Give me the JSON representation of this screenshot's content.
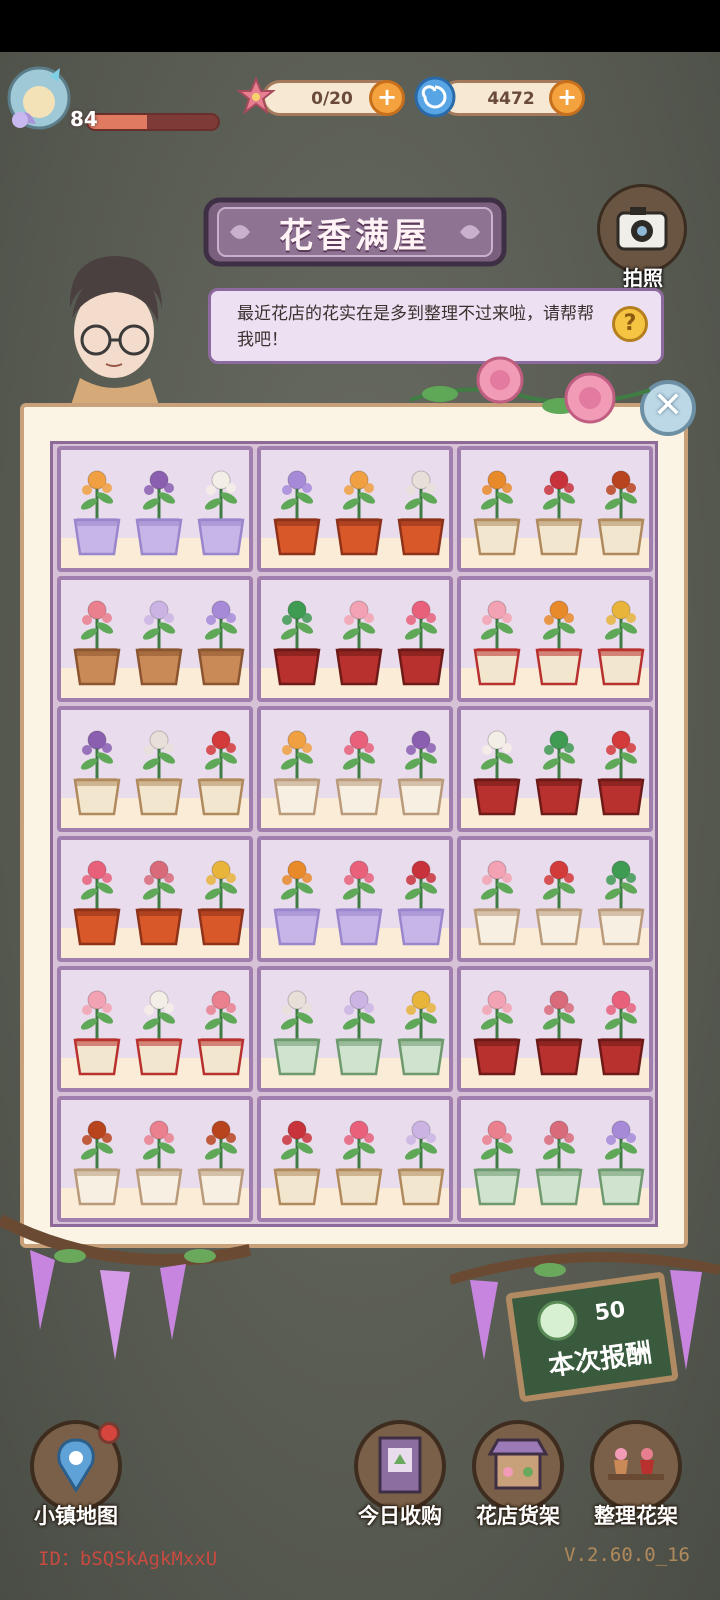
{
  "hud": {
    "level": "84",
    "level_progress": 0.45,
    "flowers": "0/20",
    "currency": "4472"
  },
  "title": "花香满屋",
  "camera_label": "拍照",
  "dialog": "最近花店的花实在是多到整理不过来啦，请帮帮我吧！",
  "help_icon": "?",
  "close_icon": "✕",
  "reward": {
    "value": "50",
    "label": "本次报酬"
  },
  "nav": {
    "map": "小镇地图",
    "purchase": "今日收购",
    "shelf": "花店货架",
    "arrange": "整理花架"
  },
  "footer": {
    "id": "ID：bSQSkAgkMxxU",
    "version": "V.2.60.0_16"
  },
  "colors": {
    "pot_cream": "#f2e6cf",
    "pot_red": "#b8312e",
    "pot_terracotta": "#c98a57",
    "pot_orange": "#d8582a",
    "pot_crystal": "#c6b6e8",
    "pot_mint": "#cfe3cf"
  },
  "shelves": [
    {
      "pots": [
        {
          "pot": "crystal",
          "flower": "orange-spike"
        },
        {
          "pot": "crystal",
          "flower": "purple-tulip"
        },
        {
          "pot": "crystal",
          "flower": "white-spike"
        }
      ]
    },
    {
      "pots": [
        {
          "pot": "orange",
          "flower": "purple-bell"
        },
        {
          "pot": "orange",
          "flower": "orange-spike"
        },
        {
          "pot": "orange",
          "flower": "lily"
        }
      ]
    },
    {
      "pots": [
        {
          "pot": "bow",
          "flower": "marigold"
        },
        {
          "pot": "bow",
          "flower": "red-rose"
        },
        {
          "pot": "bow",
          "flower": "autumn"
        }
      ]
    },
    {
      "pots": [
        {
          "pot": "terracotta",
          "flower": "pink-lily"
        },
        {
          "pot": "terracotta",
          "flower": "orchid"
        },
        {
          "pot": "terracotta",
          "flower": "purple-bell"
        }
      ]
    },
    {
      "pots": [
        {
          "pot": "red",
          "flower": "green-clover"
        },
        {
          "pot": "red",
          "flower": "pink-bloom"
        },
        {
          "pot": "red",
          "flower": "pink-rose"
        }
      ]
    },
    {
      "pots": [
        {
          "pot": "red-band",
          "flower": "pink-bloom"
        },
        {
          "pot": "red-band",
          "flower": "marigold"
        },
        {
          "pot": "red-band",
          "flower": "yellow-bush"
        }
      ]
    },
    {
      "pots": [
        {
          "pot": "bow",
          "flower": "purple-tulip"
        },
        {
          "pot": "bow",
          "flower": "lily"
        },
        {
          "pot": "bow",
          "flower": "red-daisy"
        }
      ]
    },
    {
      "pots": [
        {
          "pot": "cat",
          "flower": "orange-spike"
        },
        {
          "pot": "cat",
          "flower": "pink-rose"
        },
        {
          "pot": "cat",
          "flower": "purple-tulip"
        }
      ]
    },
    {
      "pots": [
        {
          "pot": "red",
          "flower": "white-spike"
        },
        {
          "pot": "red",
          "flower": "green-clover"
        },
        {
          "pot": "red",
          "flower": "red-daisy"
        }
      ]
    },
    {
      "pots": [
        {
          "pot": "orange",
          "flower": "pink-rose"
        },
        {
          "pot": "orange",
          "flower": "star-lily"
        },
        {
          "pot": "orange",
          "flower": "yellow-bush"
        }
      ]
    },
    {
      "pots": [
        {
          "pot": "crystal",
          "flower": "marigold"
        },
        {
          "pot": "crystal",
          "flower": "pink-rose"
        },
        {
          "pot": "crystal",
          "flower": "red-rose"
        }
      ]
    },
    {
      "pots": [
        {
          "pot": "cat",
          "flower": "pink-bloom"
        },
        {
          "pot": "cat",
          "flower": "red-daisy"
        },
        {
          "pot": "cat",
          "flower": "green-clover"
        }
      ]
    },
    {
      "pots": [
        {
          "pot": "red-band",
          "flower": "pink-bloom"
        },
        {
          "pot": "red-band",
          "flower": "white-spike"
        },
        {
          "pot": "red-band",
          "flower": "pink-lily"
        }
      ]
    },
    {
      "pots": [
        {
          "pot": "mint",
          "flower": "lily"
        },
        {
          "pot": "mint",
          "flower": "orchid"
        },
        {
          "pot": "mint",
          "flower": "yellow-bush"
        }
      ]
    },
    {
      "pots": [
        {
          "pot": "red",
          "flower": "pink-bloom"
        },
        {
          "pot": "red",
          "flower": "star-lily"
        },
        {
          "pot": "red",
          "flower": "pink-rose"
        }
      ]
    },
    {
      "pots": [
        {
          "pot": "cat",
          "flower": "autumn"
        },
        {
          "pot": "cat",
          "flower": "pink-lily"
        },
        {
          "pot": "cat",
          "flower": "autumn"
        }
      ]
    },
    {
      "pots": [
        {
          "pot": "bow",
          "flower": "red-rose"
        },
        {
          "pot": "bow",
          "flower": "pink-rose"
        },
        {
          "pot": "bow",
          "flower": "orchid"
        }
      ]
    },
    {
      "pots": [
        {
          "pot": "mint",
          "flower": "pink-lily"
        },
        {
          "pot": "mint",
          "flower": "star-lily"
        },
        {
          "pot": "mint",
          "flower": "purple-bell"
        }
      ]
    }
  ]
}
